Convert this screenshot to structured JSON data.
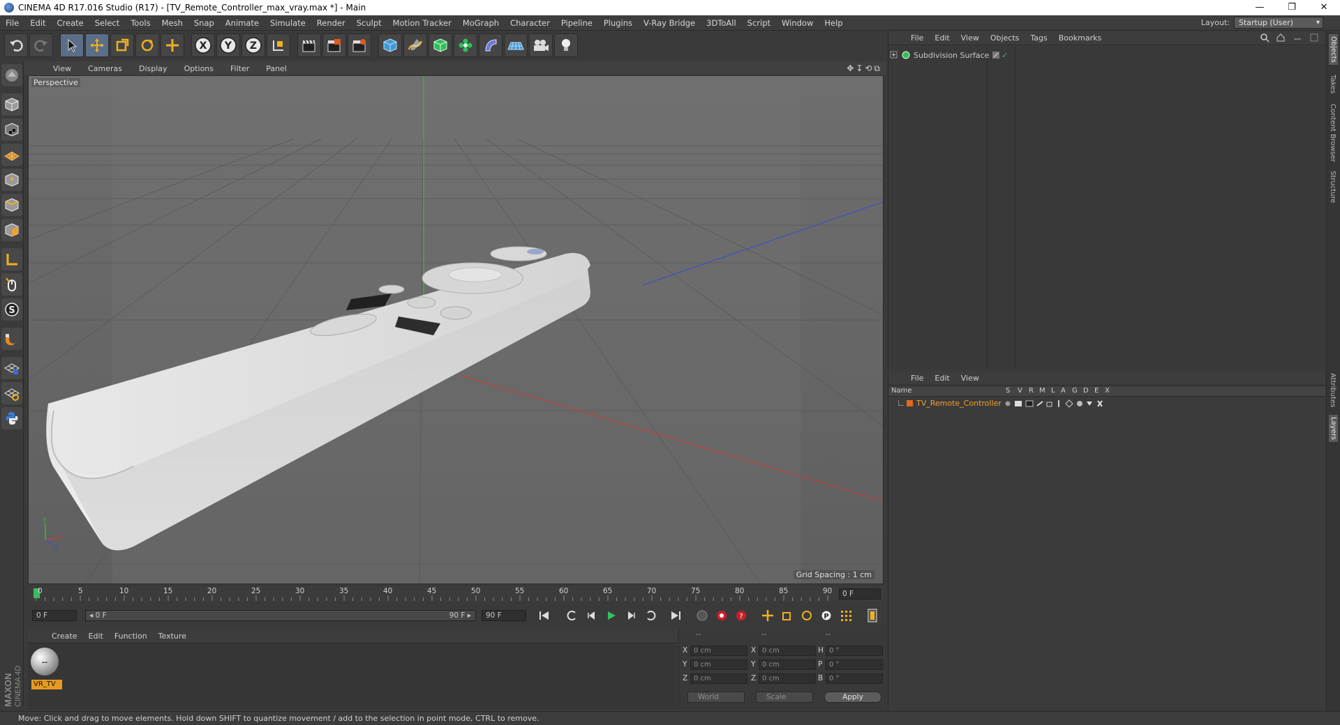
{
  "window": {
    "title": "CINEMA 4D R17.016 Studio (R17) - [TV_Remote_Controller_max_vray.max *] - Main",
    "minimize": "—",
    "restore": "❐",
    "close": "✕"
  },
  "menubar": {
    "items": [
      "File",
      "Edit",
      "Create",
      "Select",
      "Tools",
      "Mesh",
      "Snap",
      "Animate",
      "Simulate",
      "Render",
      "Sculpt",
      "Motion Tracker",
      "MoGraph",
      "Character",
      "Pipeline",
      "Plugins",
      "V-Ray Bridge",
      "3DToAll",
      "Script",
      "Window",
      "Help"
    ],
    "layout_label": "Layout:",
    "layout_value": "Startup (User)"
  },
  "toolbar": {
    "axis_x": "X",
    "axis_y": "Y",
    "axis_z": "Z"
  },
  "viewport": {
    "menu": [
      "View",
      "Cameras",
      "Display",
      "Options",
      "Filter",
      "Panel"
    ],
    "nav_icons": "✥↧⟲⧉",
    "label": "Perspective",
    "grid_spacing": "Grid Spacing : 1 cm",
    "axis_y": "Y",
    "axis_x": "X",
    "axis_z": "Z"
  },
  "timeline": {
    "ticks": [
      "0",
      "5",
      "10",
      "15",
      "20",
      "25",
      "30",
      "35",
      "40",
      "45",
      "50",
      "55",
      "60",
      "65",
      "70",
      "75",
      "80",
      "85",
      "90"
    ],
    "current_frame": "0 F"
  },
  "transport": {
    "start_field": "0 F",
    "range_start": "◂ 0 F",
    "range_end": "90 F ▸",
    "end_field": "90 F",
    "spin": "⇕"
  },
  "material_manager": {
    "menu": [
      "Create",
      "Edit",
      "Function",
      "Texture"
    ],
    "materials": [
      {
        "name": "VR_TV"
      }
    ],
    "brand_top": "MAXON",
    "brand_bottom": "CINEMA 4D"
  },
  "coordinates": {
    "headers": [
      "--",
      "--",
      "--"
    ],
    "rows": [
      {
        "a": "X",
        "v1": "0 cm",
        "b": "X",
        "v2": "0 cm",
        "c": "H",
        "v3": "0 °"
      },
      {
        "a": "Y",
        "v1": "0 cm",
        "b": "Y",
        "v2": "0 cm",
        "c": "P",
        "v3": "0 °"
      },
      {
        "a": "Z",
        "v1": "0 cm",
        "b": "Z",
        "v2": "0 cm",
        "c": "B",
        "v3": "0 °"
      }
    ],
    "mode1": "World",
    "mode2": "Scale",
    "apply": "Apply"
  },
  "objects_panel": {
    "menu": [
      "File",
      "Edit",
      "View",
      "Objects",
      "Tags",
      "Bookmarks"
    ],
    "objects": [
      {
        "name": "Subdivision Surface",
        "check": "✓"
      }
    ]
  },
  "layers_panel": {
    "menu": [
      "File",
      "Edit",
      "View"
    ],
    "columns": [
      "Name",
      "S",
      "V",
      "R",
      "M",
      "L",
      "A",
      "G",
      "D",
      "E",
      "X"
    ],
    "layers": [
      {
        "name": "TV_Remote_Controller",
        "color": "#e06a1e"
      }
    ]
  },
  "right_tabs": [
    "Objects",
    "Takes",
    "Content Browser",
    "Structure",
    "Attributes",
    "Layers"
  ],
  "status": {
    "text": "Move: Click and drag to move elements. Hold down SHIFT to quantize movement / add to the selection in point mode, CTRL to remove."
  },
  "colors": {
    "accent_blue": "#5b6e88",
    "material_label": "#e89a1f",
    "axis_x": "#c04040",
    "axis_y": "#30c030",
    "axis_z": "#4050c0"
  }
}
